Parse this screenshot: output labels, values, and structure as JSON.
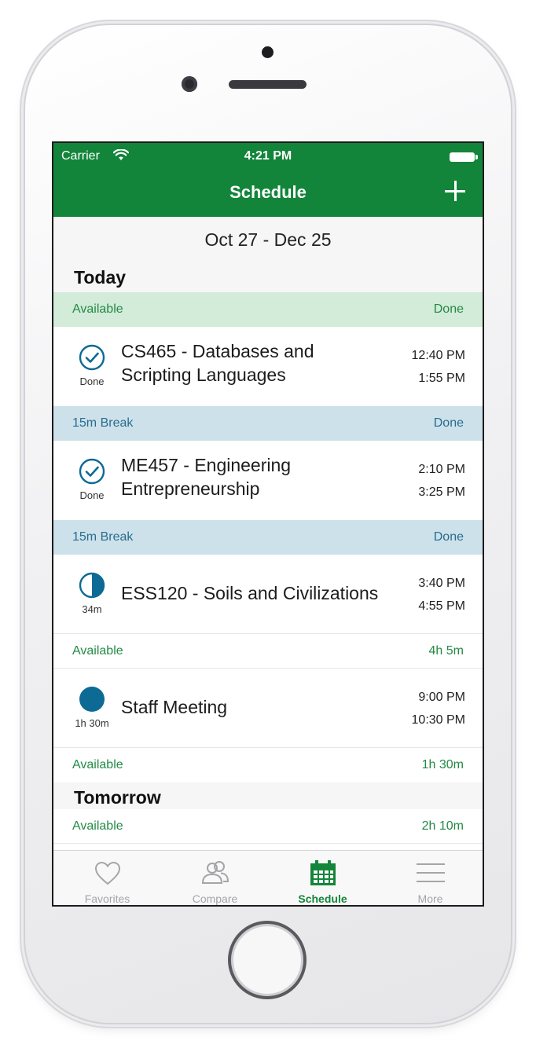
{
  "status_bar": {
    "carrier": "Carrier",
    "time": "4:21 PM"
  },
  "nav": {
    "title": "Schedule",
    "add_icon": "plus-icon"
  },
  "date_range": "Oct 27 - Dec 25",
  "sections": {
    "today": "Today",
    "tomorrow": "Tomorrow"
  },
  "schedule": [
    {
      "kind": "gap",
      "label": "Available",
      "value": "Done"
    },
    {
      "kind": "event",
      "title": "CS465 - Databases and Scripting Languages",
      "title_line1": "CS465 - Databases and",
      "title_line2": "Scripting Languages",
      "status_icon": "check-circle-icon",
      "status": "Done",
      "start": "12:40 PM",
      "end": "1:55 PM"
    },
    {
      "kind": "gap",
      "label": "15m Break",
      "value": "Done"
    },
    {
      "kind": "event",
      "title": "ME457 - Engineering Entrepreneurship",
      "title_line1": "ME457 - Engineering",
      "title_line2": "Entrepreneurship",
      "status_icon": "check-circle-icon",
      "status": "Done",
      "start": "2:10 PM",
      "end": "3:25 PM"
    },
    {
      "kind": "gap",
      "label": "15m Break",
      "value": "Done"
    },
    {
      "kind": "event",
      "title": "ESS120 - Soils and Civilizations",
      "status_icon": "progress-circle-icon",
      "status": "34m",
      "start": "3:40 PM",
      "end": "4:55 PM"
    },
    {
      "kind": "gap",
      "label": "Available",
      "value": "4h 5m"
    },
    {
      "kind": "event",
      "title": "Staff Meeting",
      "status_icon": "filled-circle-icon",
      "status": "1h 30m",
      "start": "9:00 PM",
      "end": "10:30 PM"
    },
    {
      "kind": "gap",
      "label": "Available",
      "value": "1h 30m"
    }
  ],
  "tomorrow_gap": {
    "label": "Available",
    "value": "2h 10m"
  },
  "tabs": [
    {
      "label": "Favorites",
      "icon": "heart-icon",
      "active": false
    },
    {
      "label": "Compare",
      "icon": "people-icon",
      "active": false
    },
    {
      "label": "Schedule",
      "icon": "calendar-icon",
      "active": true
    },
    {
      "label": "More",
      "icon": "menu-lines-icon",
      "active": false
    }
  ],
  "colors": {
    "accent": "#12853a",
    "available_tint": "#d3ebd9",
    "break_tint": "#cde1ea",
    "status_icon": "#0c6a94",
    "tab_inactive": "#a5a5a8"
  }
}
